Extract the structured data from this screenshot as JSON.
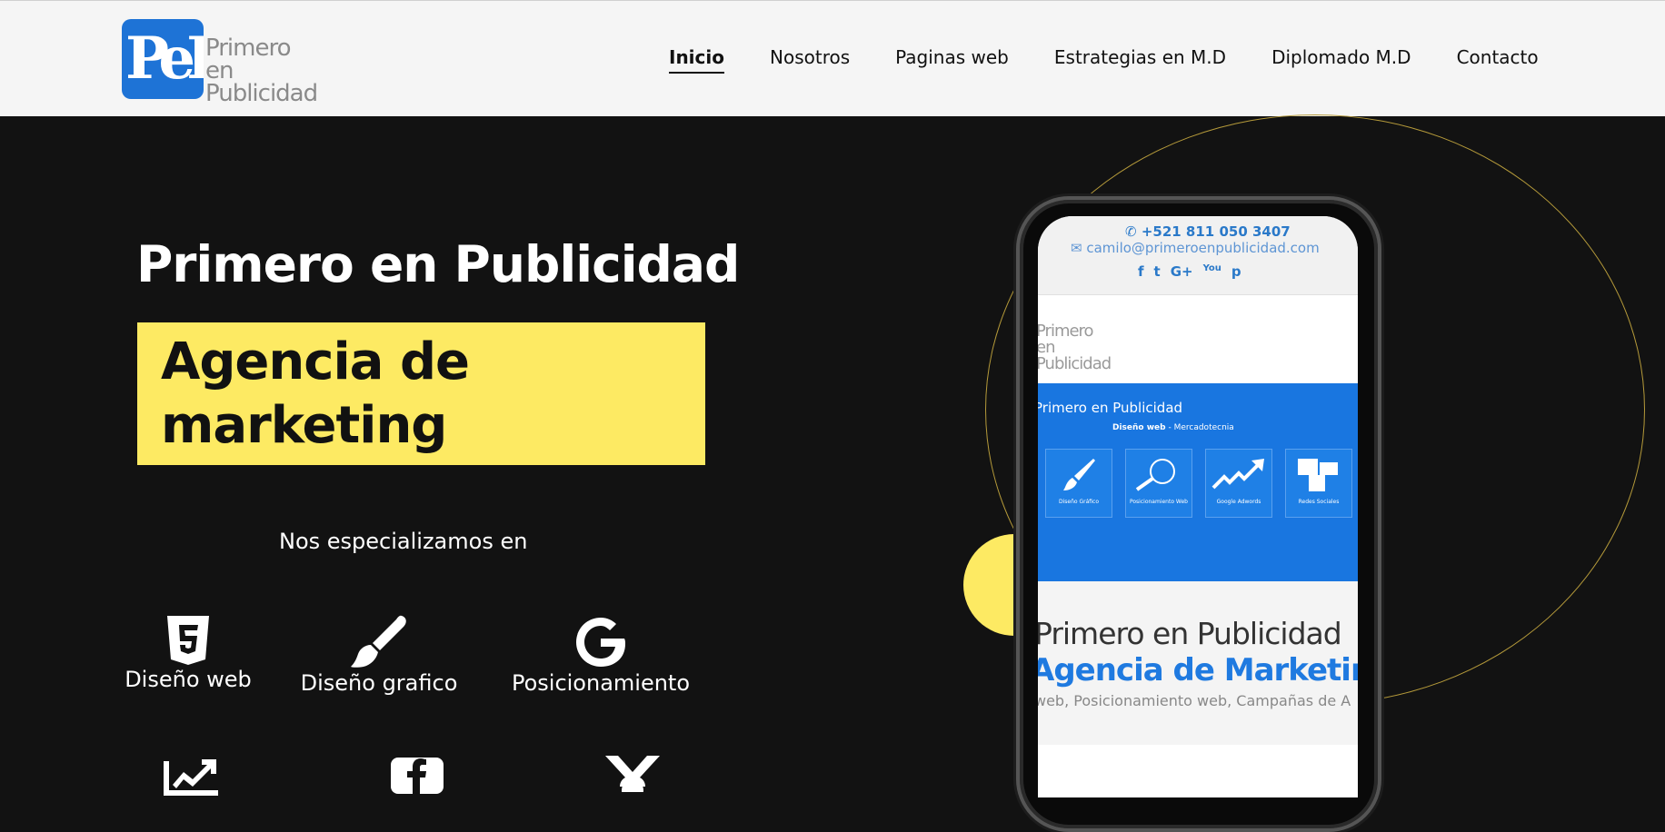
{
  "header": {
    "logo": {
      "mark": "PeP",
      "text_lines": [
        "Primero",
        "en",
        "Publicidad"
      ]
    },
    "nav": [
      {
        "label": "Inicio",
        "active": true
      },
      {
        "label": "Nosotros",
        "active": false
      },
      {
        "label": "Paginas web",
        "active": false
      },
      {
        "label": "Estrategias en M.D",
        "active": false
      },
      {
        "label": "Diplomado M.D",
        "active": false
      },
      {
        "label": "Contacto",
        "active": false
      }
    ]
  },
  "hero": {
    "title": "Primero en Publicidad",
    "subtitle_lines": [
      "Agencia de",
      "marketing"
    ],
    "specialize": "Nos especializamos en",
    "services": [
      {
        "label": "Diseño web",
        "icon": "html5-icon"
      },
      {
        "label": "Diseño grafico",
        "icon": "paintbrush-icon"
      },
      {
        "label": "Posicionamiento",
        "icon": "google-icon"
      }
    ],
    "services_row2_icons": [
      "trend-chart-icon",
      "facebook-icon",
      "medal-icon"
    ]
  },
  "phone_screen": {
    "phone": "+521 811 050 3407",
    "email": "camilo@primeroenpublicidad.com",
    "social": [
      "f",
      "t",
      "G+",
      "You",
      "p"
    ],
    "logo_lines": [
      "Primero",
      "en",
      "Publicidad"
    ],
    "band_title": "Primero en Publicidad",
    "band_sub_bold": "Diseño web",
    "band_sub_rest": " - Mercadotecnia",
    "tiles": [
      "Diseño Gráfico",
      "Posicionamiento Web",
      "Google Adwords",
      "Redes Sociales"
    ],
    "h1": "Primero en Publicidad",
    "h2": "Agencia de Marketing",
    "h3": "web, Posicionamiento web, Campañas de A"
  },
  "colors": {
    "background": "#121212",
    "header": "#f5f5f5",
    "accent_yellow": "#fdea63",
    "brand_blue": "#1976e0",
    "ring": "#b59a3a"
  }
}
